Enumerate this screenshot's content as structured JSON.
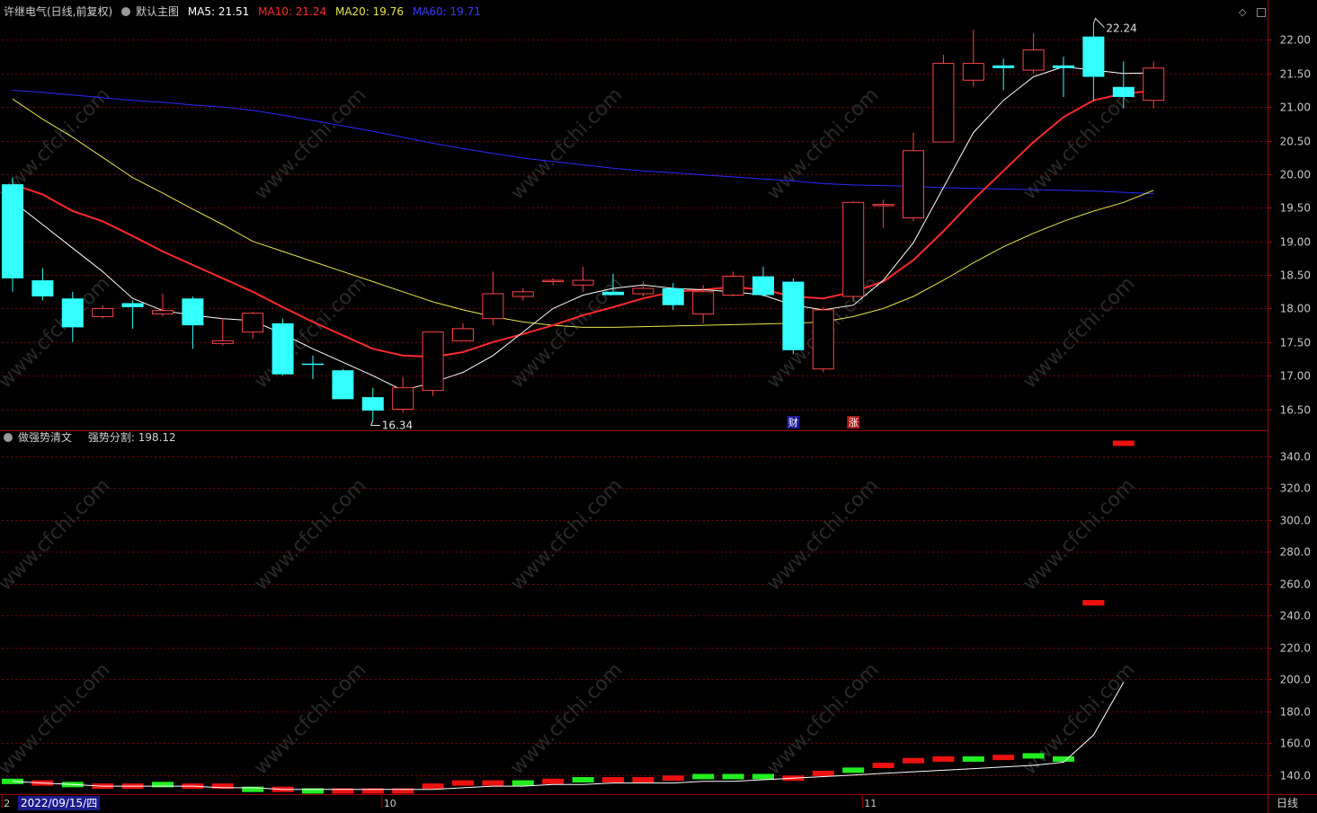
{
  "main_header": {
    "title": "许继电气(日线,前复权)",
    "template": "默认主图",
    "ma5": "MA5: 21.51",
    "ma10": "MA10: 21.24",
    "ma20": "MA20: 19.76",
    "ma60": "MA60: 19.71"
  },
  "sub_header": {
    "title": "做强势清文",
    "value": "强势分割: 198.12"
  },
  "footer": {
    "date_cursor": "2022/09/15/四",
    "period_button": "日线"
  },
  "colors": {
    "up": "#ff4444",
    "down": "#33ffff",
    "ma5": "#ffffff",
    "ma10": "#ff2a2a",
    "ma20": "#e6e64c",
    "ma60": "#2a2aff",
    "grid": "#7a0000",
    "axis_border": "#a00000",
    "watermark": "#2a2a2a"
  },
  "watermark_text": "www.cfchi.com",
  "chart_data": [
    {
      "type": "candlestick",
      "ylim": [
        16.2,
        22.3
      ],
      "yticks": [
        "22.00",
        "21.50",
        "21.00",
        "20.50",
        "20.00",
        "19.50",
        "19.00",
        "18.50",
        "18.00",
        "17.50",
        "17.00",
        "16.50"
      ],
      "x_tick_labels": [
        "2",
        "10",
        "11"
      ],
      "annotations": {
        "high_label": "22.24",
        "low_label": "16.34",
        "event_markers": [
          "财",
          "涨"
        ]
      },
      "candles": [
        {
          "o": 19.85,
          "h": 19.95,
          "l": 18.25,
          "c": 18.45
        },
        {
          "o": 18.42,
          "h": 18.6,
          "l": 18.12,
          "c": 18.18
        },
        {
          "o": 18.15,
          "h": 18.25,
          "l": 17.5,
          "c": 17.72
        },
        {
          "o": 17.88,
          "h": 18.05,
          "l": 17.85,
          "c": 18.0
        },
        {
          "o": 18.08,
          "h": 18.12,
          "l": 17.7,
          "c": 18.02
        },
        {
          "o": 17.92,
          "h": 18.22,
          "l": 17.88,
          "c": 17.97
        },
        {
          "o": 18.15,
          "h": 18.18,
          "l": 17.4,
          "c": 17.75
        },
        {
          "o": 17.48,
          "h": 17.85,
          "l": 17.45,
          "c": 17.52
        },
        {
          "o": 17.65,
          "h": 17.95,
          "l": 17.55,
          "c": 17.93
        },
        {
          "o": 17.78,
          "h": 17.85,
          "l": 17.0,
          "c": 17.02
        },
        {
          "o": 17.18,
          "h": 17.3,
          "l": 16.95,
          "c": 17.16
        },
        {
          "o": 17.08,
          "h": 17.1,
          "l": 16.65,
          "c": 16.65
        },
        {
          "o": 16.68,
          "h": 16.82,
          "l": 16.34,
          "c": 16.48
        },
        {
          "o": 16.5,
          "h": 16.98,
          "l": 16.45,
          "c": 16.82
        },
        {
          "o": 16.78,
          "h": 17.65,
          "l": 16.7,
          "c": 17.65
        },
        {
          "o": 17.52,
          "h": 17.78,
          "l": 17.52,
          "c": 17.7
        },
        {
          "o": 17.85,
          "h": 18.55,
          "l": 17.75,
          "c": 18.22
        },
        {
          "o": 18.18,
          "h": 18.3,
          "l": 18.12,
          "c": 18.25
        },
        {
          "o": 18.4,
          "h": 18.45,
          "l": 18.35,
          "c": 18.42
        },
        {
          "o": 18.35,
          "h": 18.62,
          "l": 18.25,
          "c": 18.42
        },
        {
          "o": 18.25,
          "h": 18.52,
          "l": 18.2,
          "c": 18.2
        },
        {
          "o": 18.22,
          "h": 18.4,
          "l": 18.18,
          "c": 18.3
        },
        {
          "o": 18.3,
          "h": 18.38,
          "l": 17.98,
          "c": 18.05
        },
        {
          "o": 17.92,
          "h": 18.35,
          "l": 17.78,
          "c": 18.25
        },
        {
          "o": 18.2,
          "h": 18.55,
          "l": 18.18,
          "c": 18.48
        },
        {
          "o": 18.48,
          "h": 18.62,
          "l": 18.18,
          "c": 18.2
        },
        {
          "o": 18.4,
          "h": 18.45,
          "l": 17.32,
          "c": 17.38
        },
        {
          "o": 17.1,
          "h": 18.02,
          "l": 17.05,
          "c": 17.98
        },
        {
          "o": 18.18,
          "h": 19.6,
          "l": 18.1,
          "c": 19.58
        },
        {
          "o": 19.55,
          "h": 19.62,
          "l": 19.2,
          "c": 19.55
        },
        {
          "o": 19.35,
          "h": 20.62,
          "l": 19.3,
          "c": 20.35
        },
        {
          "o": 20.48,
          "h": 21.78,
          "l": 20.48,
          "c": 21.65
        },
        {
          "o": 21.4,
          "h": 22.15,
          "l": 21.3,
          "c": 21.65
        },
        {
          "o": 21.62,
          "h": 21.72,
          "l": 21.25,
          "c": 21.58
        },
        {
          "o": 21.55,
          "h": 22.1,
          "l": 21.5,
          "c": 21.85
        },
        {
          "o": 21.62,
          "h": 21.75,
          "l": 21.15,
          "c": 21.58
        },
        {
          "o": 22.05,
          "h": 22.24,
          "l": 21.1,
          "c": 21.45
        },
        {
          "o": 21.3,
          "h": 21.68,
          "l": 20.98,
          "c": 21.15
        },
        {
          "o": 21.1,
          "h": 21.68,
          "l": 20.98,
          "c": 21.58
        }
      ],
      "ma5": [
        19.6,
        19.25,
        18.9,
        18.55,
        18.15,
        17.97,
        17.9,
        17.85,
        17.82,
        17.62,
        17.4,
        17.2,
        17.0,
        16.78,
        16.9,
        17.05,
        17.3,
        17.65,
        18.0,
        18.2,
        18.3,
        18.35,
        18.3,
        18.28,
        18.25,
        18.2,
        18.05,
        17.98,
        18.05,
        18.42,
        18.98,
        19.8,
        20.62,
        21.1,
        21.45,
        21.6,
        21.55,
        21.5,
        21.51
      ],
      "ma10": [
        19.85,
        19.7,
        19.45,
        19.3,
        19.08,
        18.85,
        18.65,
        18.45,
        18.25,
        18.02,
        17.8,
        17.6,
        17.4,
        17.3,
        17.28,
        17.35,
        17.5,
        17.62,
        17.75,
        17.9,
        18.02,
        18.15,
        18.25,
        18.28,
        18.32,
        18.28,
        18.18,
        18.15,
        18.25,
        18.4,
        18.72,
        19.15,
        19.62,
        20.05,
        20.48,
        20.85,
        21.1,
        21.2,
        21.24
      ],
      "ma20": [
        21.12,
        20.82,
        20.55,
        20.25,
        19.95,
        19.72,
        19.48,
        19.25,
        19.0,
        18.85,
        18.7,
        18.55,
        18.4,
        18.25,
        18.1,
        17.98,
        17.88,
        17.8,
        17.75,
        17.72,
        17.72,
        17.73,
        17.74,
        17.75,
        17.76,
        17.77,
        17.78,
        17.8,
        17.88,
        18.0,
        18.18,
        18.42,
        18.68,
        18.92,
        19.12,
        19.3,
        19.45,
        19.58,
        19.76
      ],
      "ma60": [
        21.25,
        21.22,
        21.18,
        21.14,
        21.1,
        21.07,
        21.03,
        21.0,
        20.95,
        20.88,
        20.8,
        20.72,
        20.64,
        20.55,
        20.46,
        20.38,
        20.31,
        20.24,
        20.19,
        20.14,
        20.09,
        20.05,
        20.02,
        19.99,
        19.96,
        19.93,
        19.9,
        19.86,
        19.84,
        19.83,
        19.82,
        19.8,
        19.79,
        19.78,
        19.77,
        19.76,
        19.75,
        19.73,
        19.71
      ]
    },
    {
      "type": "bar",
      "ylim": [
        128,
        355
      ],
      "yticks": [
        "340.0",
        "320.0",
        "300.0",
        "280.0",
        "260.0",
        "240.0",
        "220.0",
        "200.0",
        "180.0",
        "160.0",
        "140.0"
      ],
      "bars": [
        {
          "v": 136,
          "s": "g"
        },
        {
          "v": 135,
          "s": "r"
        },
        {
          "v": 134,
          "s": "g"
        },
        {
          "v": 133,
          "s": "r"
        },
        {
          "v": 133,
          "s": "r"
        },
        {
          "v": 134,
          "s": "g"
        },
        {
          "v": 133,
          "s": "r"
        },
        {
          "v": 133,
          "s": "r"
        },
        {
          "v": 131,
          "s": "g"
        },
        {
          "v": 131,
          "s": "r"
        },
        {
          "v": 130,
          "s": "g"
        },
        {
          "v": 130,
          "s": "r"
        },
        {
          "v": 130,
          "s": "r"
        },
        {
          "v": 130,
          "s": "r"
        },
        {
          "v": 133,
          "s": "r"
        },
        {
          "v": 135,
          "s": "r"
        },
        {
          "v": 135,
          "s": "r"
        },
        {
          "v": 135,
          "s": "g"
        },
        {
          "v": 136,
          "s": "r"
        },
        {
          "v": 137,
          "s": "g"
        },
        {
          "v": 137,
          "s": "r"
        },
        {
          "v": 137,
          "s": "r"
        },
        {
          "v": 138,
          "s": "r"
        },
        {
          "v": 139,
          "s": "g"
        },
        {
          "v": 139,
          "s": "g"
        },
        {
          "v": 139,
          "s": "g"
        },
        {
          "v": 138,
          "s": "r"
        },
        {
          "v": 141,
          "s": "r"
        },
        {
          "v": 143,
          "s": "g"
        },
        {
          "v": 146,
          "s": "r"
        },
        {
          "v": 149,
          "s": "r"
        },
        {
          "v": 150,
          "s": "r"
        },
        {
          "v": 150,
          "s": "g"
        },
        {
          "v": 151,
          "s": "r"
        },
        {
          "v": 152,
          "s": "g"
        },
        {
          "v": 150,
          "s": "g"
        },
        {
          "v": 248,
          "s": "r"
        },
        {
          "v": 348,
          "s": "r"
        }
      ],
      "line": [
        136,
        135,
        134,
        133,
        133,
        133,
        133,
        132,
        132,
        131,
        131,
        131,
        131,
        131,
        131,
        132,
        133,
        133,
        134,
        134,
        135,
        135,
        135,
        136,
        136,
        137,
        138,
        139,
        140,
        141,
        142,
        143,
        144,
        145,
        146,
        148,
        165,
        198.12
      ]
    }
  ]
}
